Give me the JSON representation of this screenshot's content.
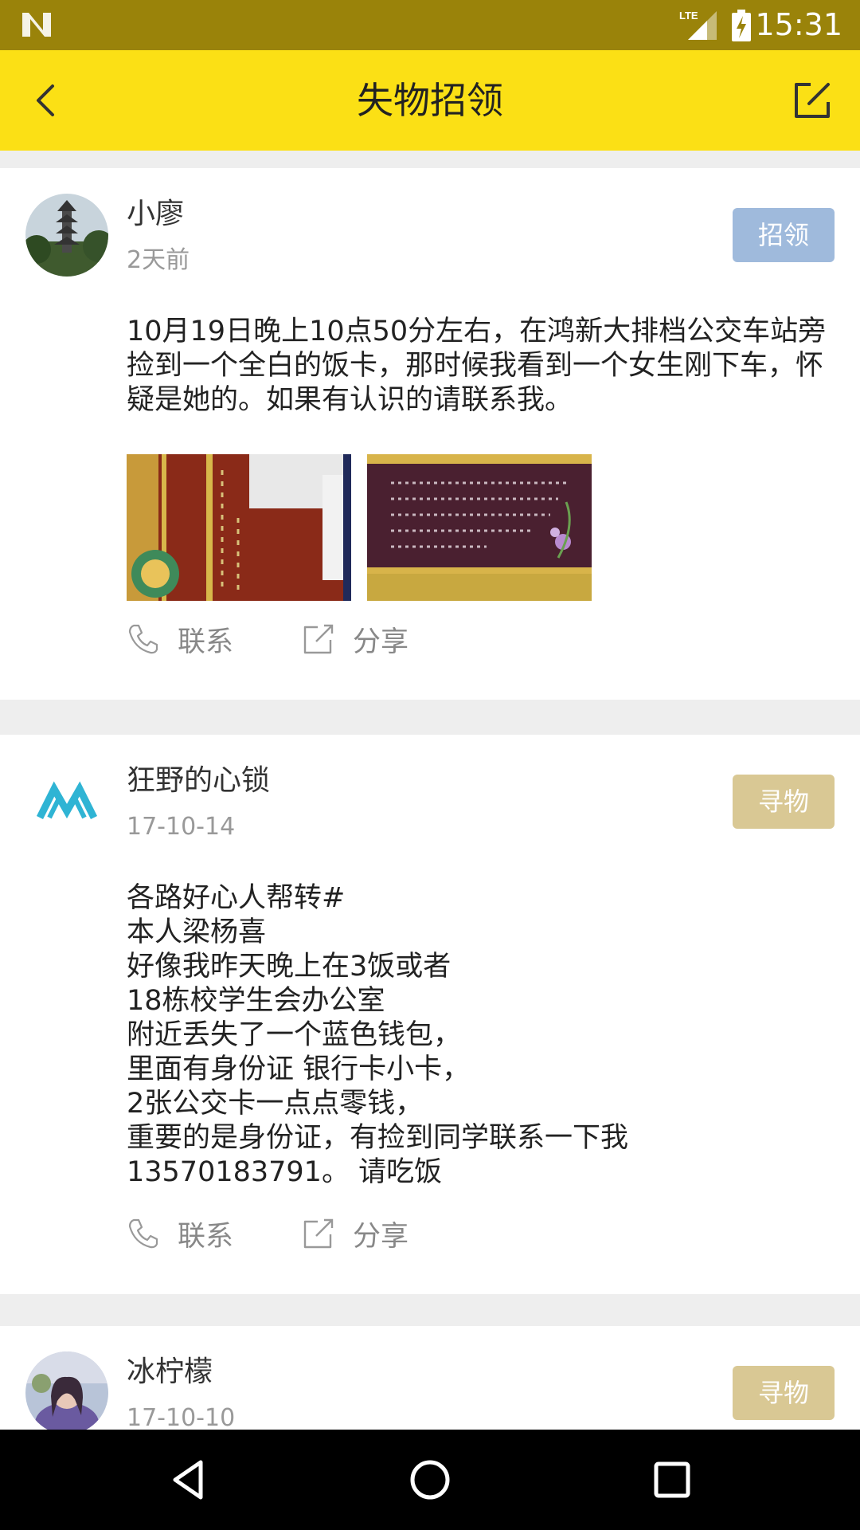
{
  "status_bar": {
    "time": "15:31",
    "network": "LTE",
    "icons": [
      "n-logo-icon",
      "lte-signal-icon",
      "battery-charging-icon"
    ]
  },
  "app_bar": {
    "title": "失物招领",
    "back_icon": "chevron-left-icon",
    "compose_icon": "edit-icon"
  },
  "posts": [
    {
      "username": "小廖",
      "date": "2天前",
      "tag": "招领",
      "tag_color": "#9fbadc",
      "content": "10月19日晚上10点50分左右，在鸿新大排档公交车站旁捡到一个全白的饭卡，那时候我看到一个女生刚下车，怀疑是她的。如果有认识的请联系我。",
      "contact_label": "联系",
      "share_label": "分享"
    },
    {
      "username": "狂野的心锁",
      "date": "17-10-14",
      "tag": "寻物",
      "tag_color": "#d9c894",
      "content": "各路好心人帮转#\n本人梁杨喜\n好像我昨天晚上在3饭或者\n18栋校学生会办公室\n附近丢失了一个蓝色钱包，\n里面有身份证 银行卡小卡，\n2张公交卡一点点零钱，\n重要的是身份证，有捡到同学联系一下我\n13570183791。 请吃饭",
      "contact_label": "联系",
      "share_label": "分享"
    },
    {
      "username": "冰柠檬",
      "date": "17-10-10",
      "tag": "寻物",
      "tag_color": "#d9c894"
    }
  ],
  "nav_bar": {
    "icons": [
      "back-triangle-icon",
      "home-circle-icon",
      "recents-square-icon"
    ]
  }
}
